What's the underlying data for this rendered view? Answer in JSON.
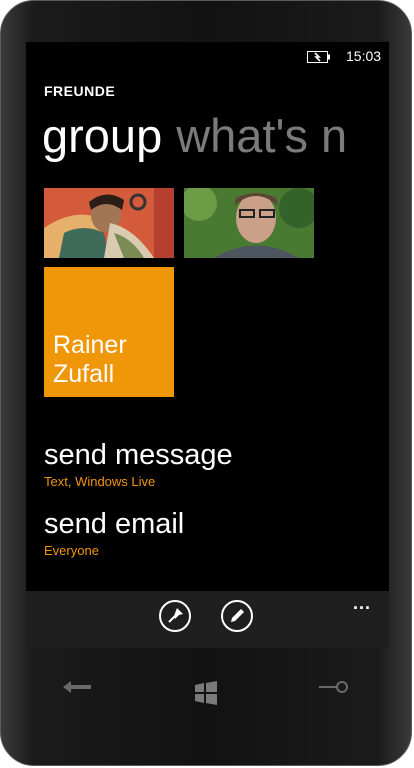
{
  "status_bar": {
    "time": "15:03"
  },
  "app": {
    "title": "FREUNDE"
  },
  "pivot": {
    "active": "group",
    "next": "what's n"
  },
  "contact_tile": {
    "name": "Rainer\nZufall",
    "color": "#f09609"
  },
  "actions": [
    {
      "label": "send message",
      "sub": "Text, Windows Live"
    },
    {
      "label": "send email",
      "sub": "Everyone"
    }
  ],
  "app_bar": {
    "buttons": [
      "pin-icon",
      "edit-icon"
    ],
    "more": "..."
  },
  "hardware": {
    "buttons": [
      "back-icon",
      "windows-start-icon",
      "search-icon"
    ]
  },
  "colors": {
    "accent": "#f09609",
    "background": "#000000",
    "inactive_text": "#7b7b7b"
  }
}
